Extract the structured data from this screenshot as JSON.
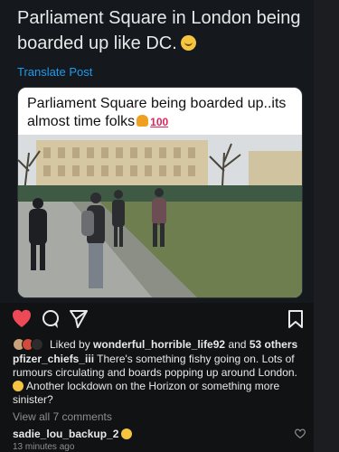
{
  "tweet": {
    "text": "Parliament Square in London being boarded up like DC.",
    "emoji_icon": "smirking-face-icon",
    "translate_label": "Translate Post"
  },
  "embed": {
    "caption": "Parliament Square being boarded up..its almost time folks",
    "emoji_icon": "flexed-biceps-icon",
    "hundred_label": "100"
  },
  "post": {
    "likes_prefix": "Liked by",
    "liked_by_user": "wonderful_horrible_life92",
    "likes_and": "and",
    "likes_others": "53 others",
    "comment_user": "pfizer_chiefs_iii",
    "comment_text": "There's something fishy going on. Lots of rumours circulating and boards popping up around London.",
    "comment_text_2": "Another lockdown on the Horizon or something more sinister?",
    "view_all": "View all 7 comments",
    "reply_user": "sadie_lou_backup_2",
    "time": "13 minutes ago"
  },
  "colors": {
    "background": "#111214",
    "like_red": "#ed4956",
    "link_blue": "#1d9bf0"
  }
}
